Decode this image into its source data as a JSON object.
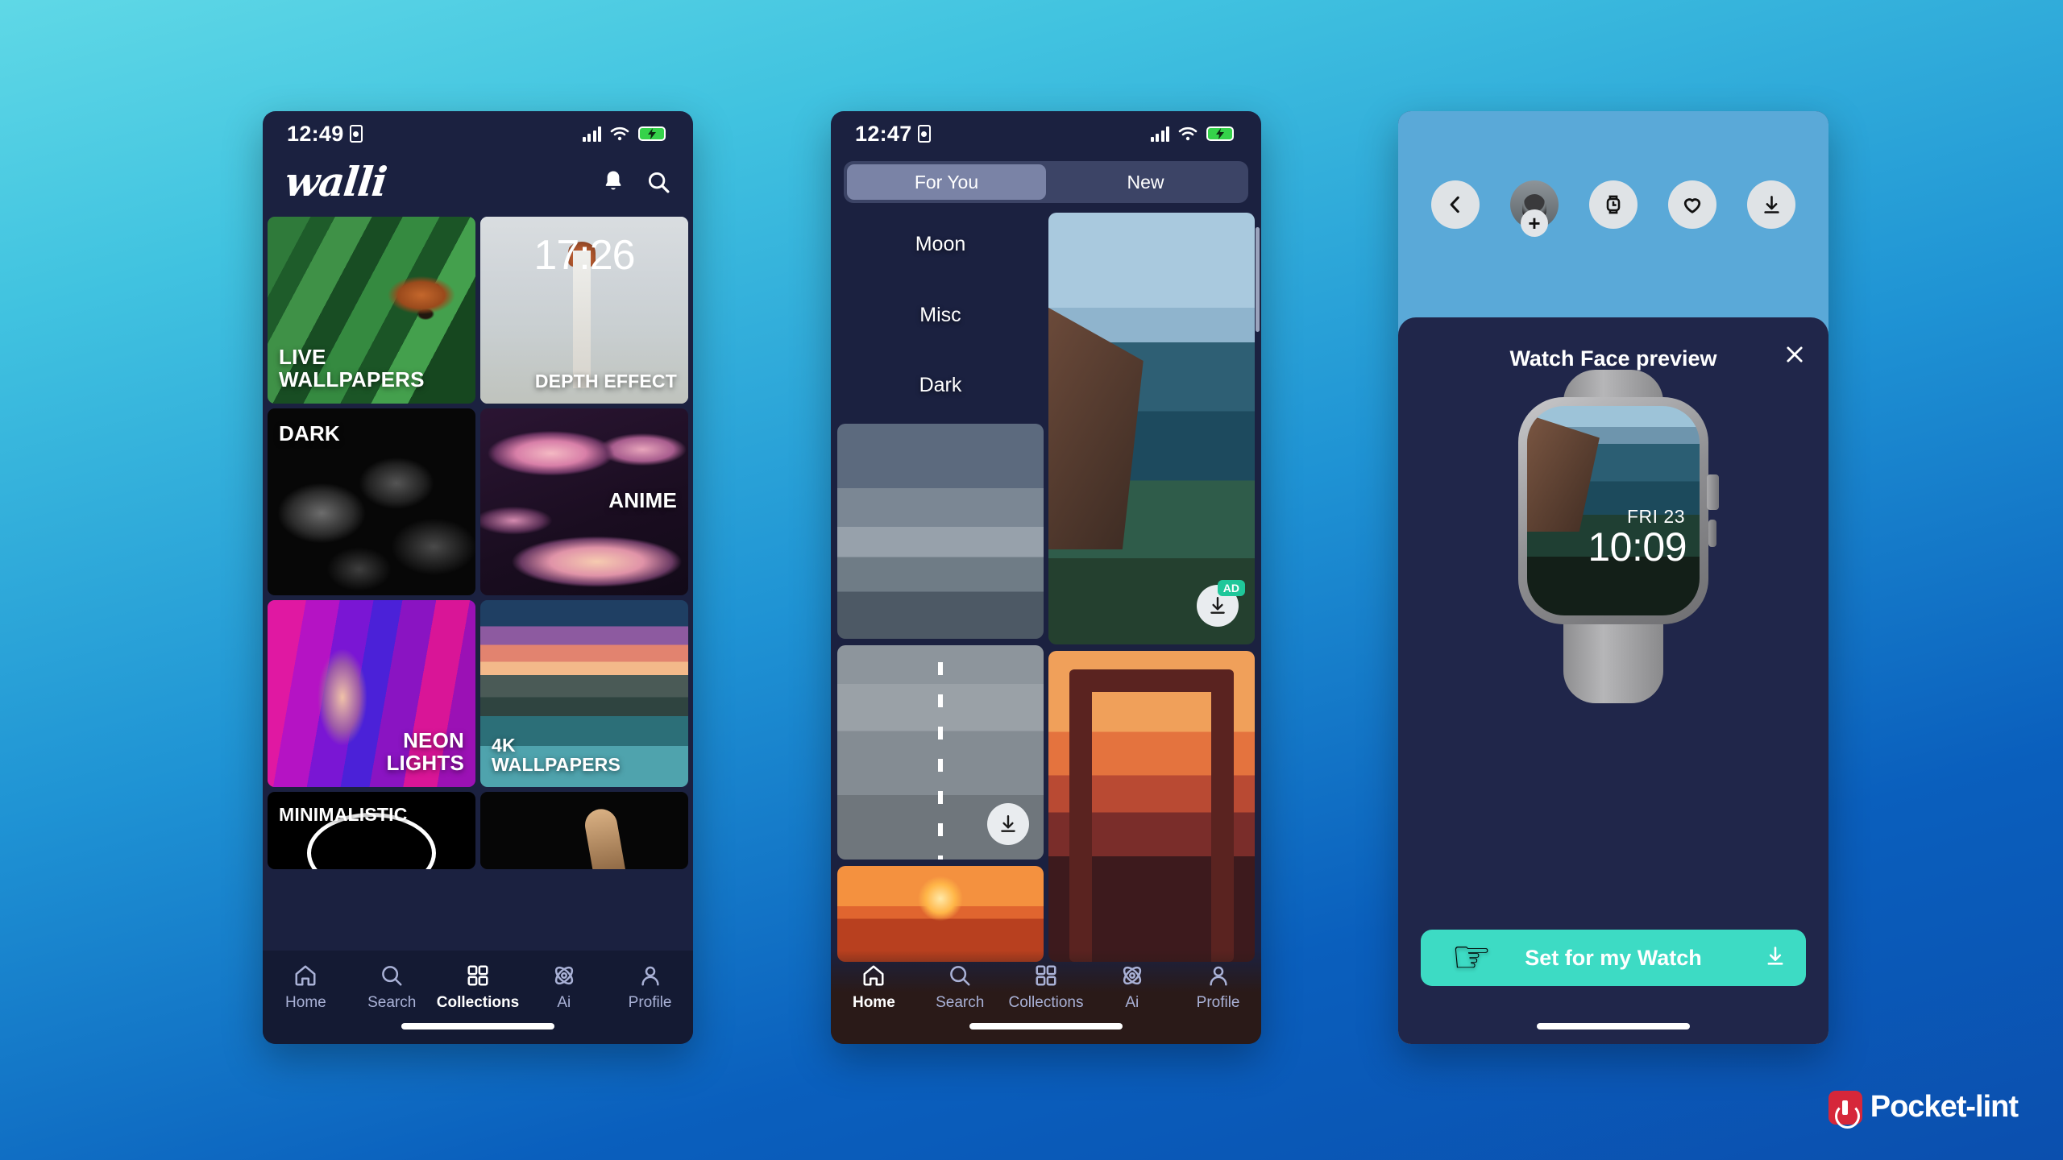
{
  "background": {
    "top_color": "#5fd8e6",
    "bottom_color": "#0b4fae"
  },
  "watermark": {
    "text": "Pocket-lint",
    "logo_color": "#d6273a"
  },
  "phone1": {
    "status": {
      "time": "12:49",
      "record_icon": "screen-record-icon",
      "signal_icon": "cellular-icon",
      "wifi_icon": "wifi-icon",
      "battery_icon": "battery-charging-icon"
    },
    "header": {
      "logo": "walli",
      "bell_icon": "bell-icon",
      "search_icon": "search-icon"
    },
    "tiles": [
      {
        "label": "LIVE\nWALLPAPERS",
        "art": "art-fox",
        "align": "left"
      },
      {
        "label": "DEPTH EFFECT",
        "art": "art-light",
        "align": "right",
        "overlay_time": "17:26"
      },
      {
        "label": "DARK",
        "art": "art-dark",
        "align": "left"
      },
      {
        "label": "ANIME",
        "art": "art-anime",
        "align": "right"
      },
      {
        "label": "NEON\nLIGHTS",
        "art": "art-neon",
        "align": "right"
      },
      {
        "label": "4K\nWALLPAPERS",
        "art": "art-4k",
        "align": "left"
      },
      {
        "label": "MINIMALISTIC",
        "art": "art-minimal",
        "align": "left"
      },
      {
        "label": "",
        "art": "art-hand",
        "align": "left"
      }
    ],
    "tabs": [
      {
        "label": "Home",
        "icon": "home-icon",
        "active": false
      },
      {
        "label": "Search",
        "icon": "search-icon",
        "active": false
      },
      {
        "label": "Collections",
        "icon": "grid-icon",
        "active": true
      },
      {
        "label": "Ai",
        "icon": "atom-icon",
        "active": false
      },
      {
        "label": "Profile",
        "icon": "person-icon",
        "active": false
      }
    ]
  },
  "phone2": {
    "status": {
      "time": "12:47",
      "record_icon": "screen-record-icon",
      "signal_icon": "cellular-icon",
      "wifi_icon": "wifi-icon",
      "battery_icon": "battery-charging-icon"
    },
    "segments": [
      {
        "label": "For You",
        "selected": true
      },
      {
        "label": "New",
        "selected": false
      }
    ],
    "chips": [
      {
        "label": "Moon",
        "art": "art-moon"
      },
      {
        "label": "Misc",
        "art": "art-misc"
      },
      {
        "label": "Dark",
        "art": "art-dark2"
      }
    ],
    "left_wallpapers": [
      {
        "art": "art-storm",
        "download": false
      },
      {
        "art": "art-road",
        "download": true,
        "download_icon": "download-icon"
      },
      {
        "art": "art-sunsetsea",
        "download": false
      }
    ],
    "right_wallpapers": [
      {
        "art": "art-cliff",
        "download": true,
        "download_icon": "download-icon",
        "badge": "AD"
      },
      {
        "art": "art-sunsetdoor",
        "download": false
      }
    ],
    "tabs": [
      {
        "label": "Home",
        "icon": "home-icon",
        "active": true
      },
      {
        "label": "Search",
        "icon": "search-icon",
        "active": false
      },
      {
        "label": "Collections",
        "icon": "grid-icon",
        "active": false
      },
      {
        "label": "Ai",
        "icon": "atom-icon",
        "active": false
      },
      {
        "label": "Profile",
        "icon": "person-icon",
        "active": false
      }
    ]
  },
  "phone3": {
    "top_actions": [
      {
        "name": "back-button",
        "icon": "chevron-left-icon"
      },
      {
        "name": "add-avatar-button",
        "icon": "avatar-plus-icon"
      },
      {
        "name": "watch-button",
        "icon": "watch-icon"
      },
      {
        "name": "favorite-button",
        "icon": "heart-icon"
      },
      {
        "name": "download-button",
        "icon": "download-icon"
      }
    ],
    "sheet": {
      "title": "Watch Face preview",
      "close_icon": "close-icon"
    },
    "watch": {
      "date": "FRI 23",
      "time": "10:09"
    },
    "cta": {
      "label": "Set for my Watch",
      "icon": "download-icon",
      "cursor": "pointing-hand-cursor",
      "color": "#3ddbc4"
    }
  }
}
